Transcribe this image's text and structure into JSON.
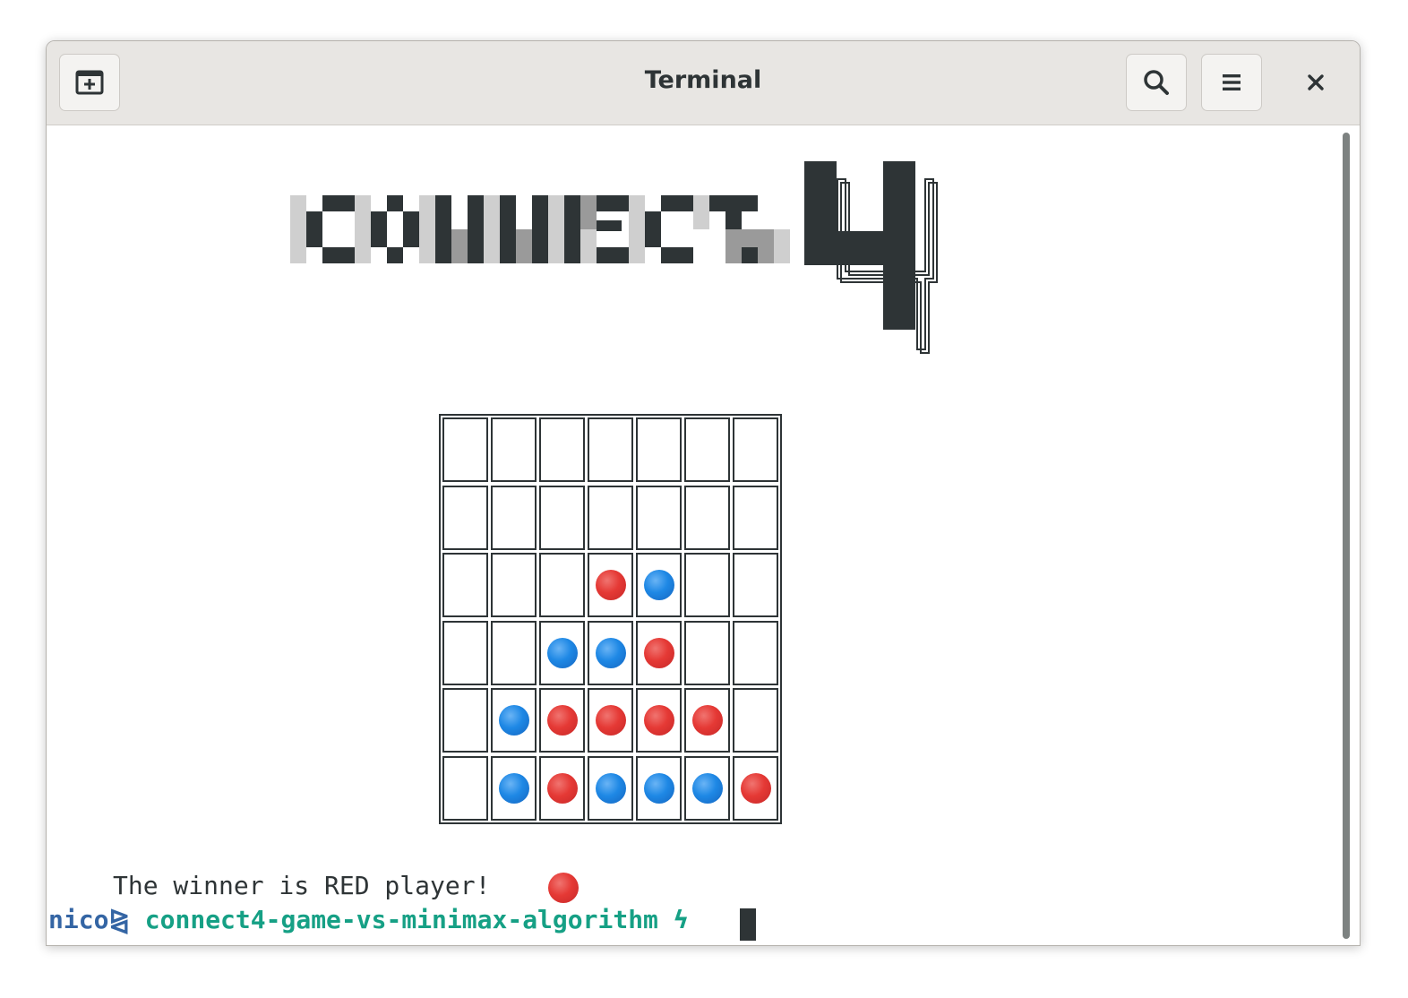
{
  "window": {
    "title": "Terminal",
    "new_tab_icon": "new-tab-icon",
    "search_icon": "search-icon",
    "menu_icon": "hamburger-menu-icon",
    "close_icon": "close-icon"
  },
  "logo": {
    "text": "CONNECT 4",
    "letters": "CONNECT",
    "digit": "4"
  },
  "board": {
    "columns": 7,
    "rows": 6,
    "cells": [
      [
        "",
        "",
        "",
        "",
        "",
        "",
        ""
      ],
      [
        "",
        "",
        "",
        "",
        "",
        "",
        ""
      ],
      [
        "",
        "",
        "",
        "red",
        "blue",
        "",
        ""
      ],
      [
        "",
        "",
        "blue",
        "blue",
        "red",
        "",
        ""
      ],
      [
        "",
        "blue",
        "red",
        "red",
        "red",
        "red",
        ""
      ],
      [
        "",
        "blue",
        "red",
        "blue",
        "blue",
        "blue",
        "red"
      ]
    ]
  },
  "output": {
    "winner_message": "The winner is RED player!",
    "winner_disc": "red"
  },
  "prompt": {
    "user": "nico",
    "separator": "⧎",
    "directory": "connect4-game-vs-minimax-algorithm",
    "symbol": "ϟ"
  },
  "colors": {
    "red_disc": "#e53935",
    "blue_disc": "#1e88e5",
    "prompt_user": "#3465a4",
    "prompt_dir": "#16a085",
    "text": "#2e3436"
  }
}
